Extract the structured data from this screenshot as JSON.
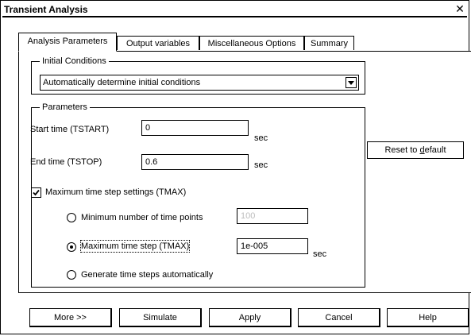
{
  "window": {
    "title": "Transient Analysis"
  },
  "tabs": [
    {
      "label": "Analysis Parameters",
      "active": true
    },
    {
      "label": "Output variables",
      "active": false
    },
    {
      "label": "Miscellaneous Options",
      "active": false
    },
    {
      "label": "Summary",
      "active": false
    }
  ],
  "initial_conditions": {
    "legend": "Initial Conditions",
    "selected": "Automatically determine initial conditions"
  },
  "parameters": {
    "legend": "Parameters",
    "start_time": {
      "label": "Start time (TSTART)",
      "value": "0",
      "unit": "sec"
    },
    "end_time": {
      "label": "End time (TSTOP)",
      "value": "0.6",
      "unit": "sec"
    },
    "tmax_settings": {
      "label": "Maximum time step settings (TMAX)",
      "checked": true
    },
    "min_points": {
      "label": "Minimum number of time points",
      "value": "100",
      "enabled": false,
      "selected": false
    },
    "max_step": {
      "label": "Maximum time step (TMAX)",
      "value": "1e-005",
      "unit": "sec",
      "selected": true
    },
    "auto_steps": {
      "label": "Generate time steps automatically",
      "selected": false
    }
  },
  "reset_button": {
    "pre": "Reset to ",
    "accel": "d",
    "post": "efault"
  },
  "footer": {
    "more": "More >>",
    "simulate": "Simulate",
    "apply": "Apply",
    "cancel": "Cancel",
    "help": "Help"
  }
}
